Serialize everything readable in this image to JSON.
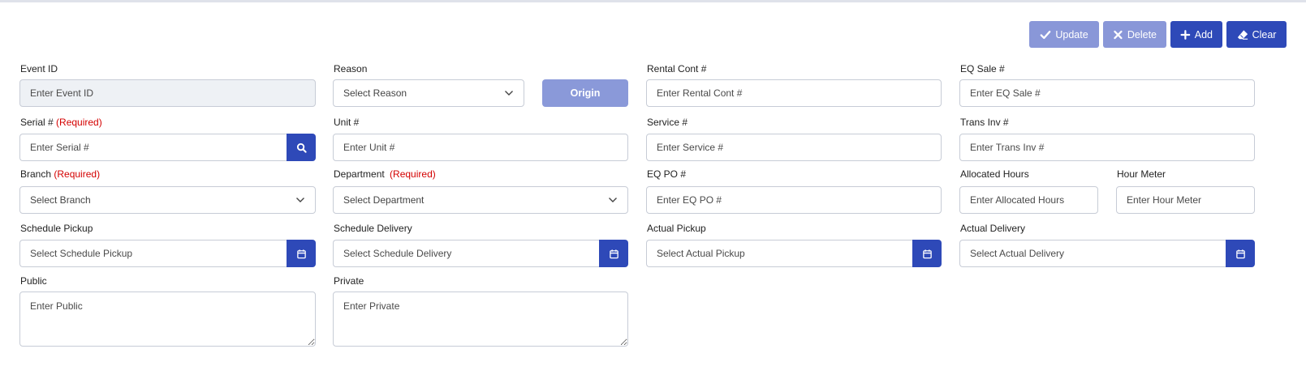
{
  "toolbar": {
    "update_label": "Update",
    "delete_label": "Delete",
    "add_label": "Add",
    "clear_label": "Clear"
  },
  "form": {
    "event_id": {
      "label": "Event ID",
      "placeholder": "Enter Event ID"
    },
    "reason": {
      "label": "Reason",
      "value": "Select Reason"
    },
    "origin_button": "Origin",
    "rental_cont": {
      "label": "Rental Cont #",
      "placeholder": "Enter Rental Cont #"
    },
    "eq_sale": {
      "label": "EQ Sale #",
      "placeholder": "Enter EQ Sale #"
    },
    "serial": {
      "label": "Serial #",
      "required": "(Required)",
      "placeholder": "Enter Serial #"
    },
    "unit": {
      "label": "Unit #",
      "placeholder": "Enter Unit #"
    },
    "service": {
      "label": "Service #",
      "placeholder": "Enter Service #"
    },
    "trans_inv": {
      "label": "Trans Inv #",
      "placeholder": "Enter Trans Inv #"
    },
    "branch": {
      "label": "Branch",
      "required": "(Required)",
      "value": "Select Branch"
    },
    "department": {
      "label": "Department",
      "required": "(Required)",
      "value": "Select Department"
    },
    "eq_po": {
      "label": "EQ PO #",
      "placeholder": "Enter EQ PO #"
    },
    "allocated_hours": {
      "label": "Allocated Hours",
      "placeholder": "Enter Allocated Hours"
    },
    "hour_meter": {
      "label": "Hour Meter",
      "placeholder": "Enter Hour Meter"
    },
    "schedule_pickup": {
      "label": "Schedule Pickup",
      "placeholder": "Select Schedule Pickup"
    },
    "schedule_delivery": {
      "label": "Schedule Delivery",
      "placeholder": "Select Schedule Delivery"
    },
    "actual_pickup": {
      "label": "Actual Pickup",
      "placeholder": "Select Actual Pickup"
    },
    "actual_delivery": {
      "label": "Actual Delivery",
      "placeholder": "Select Actual Delivery"
    },
    "public": {
      "label": "Public",
      "placeholder": "Enter Public"
    },
    "private": {
      "label": "Private",
      "placeholder": "Enter Private"
    }
  },
  "colors": {
    "primary": "#2e49b8",
    "primary_disabled": "#8997d8",
    "required": "#d40000",
    "border": "#c7ccd6",
    "disabled_bg": "#eef1f5"
  },
  "icons": {
    "update": "check-icon",
    "delete": "x-icon",
    "add": "plus-icon",
    "clear": "eraser-icon",
    "serial_lookup": "search-icon",
    "date_picker": "calendar-icon",
    "dropdown": "chevron-down-icon"
  }
}
